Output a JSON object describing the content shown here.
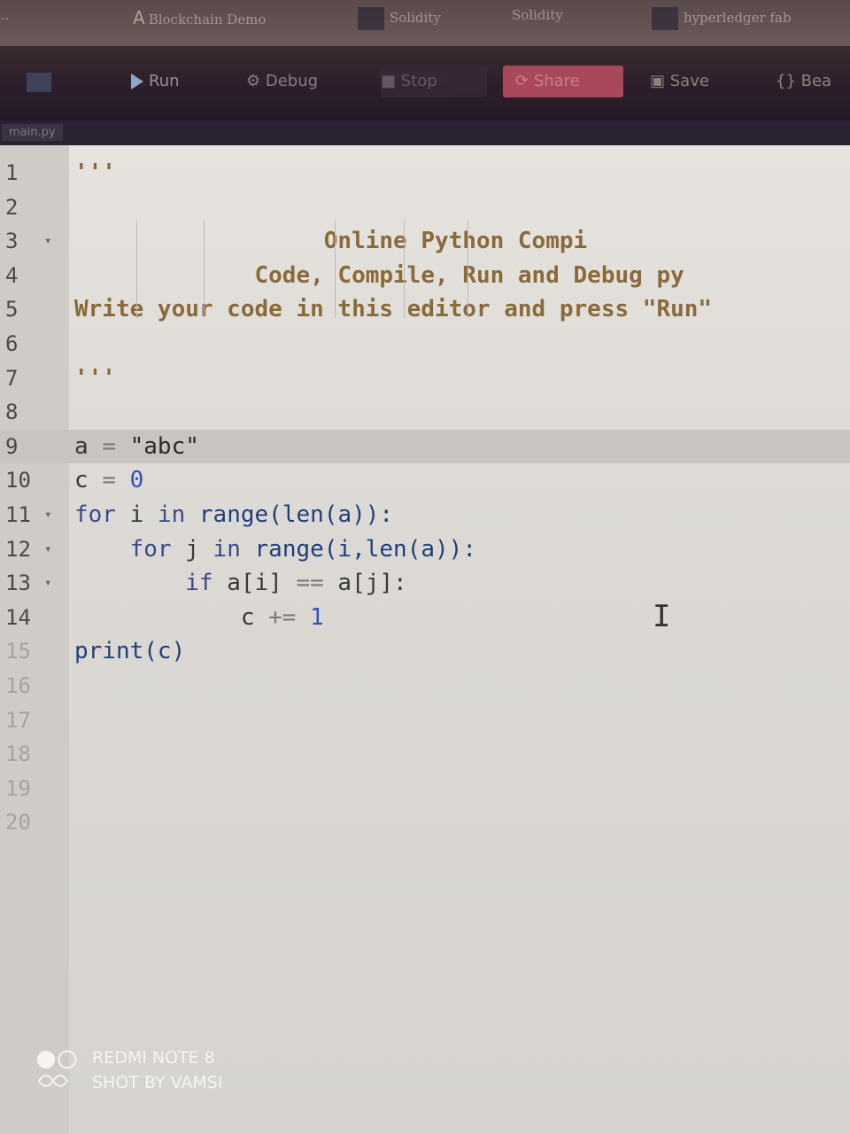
{
  "bookmarks": [
    {
      "label": "...",
      "icon": "bookmark-icon"
    },
    {
      "label": "Blockchain Demo",
      "icon": "letter-a-icon"
    },
    {
      "label": "Solidity",
      "icon": "bookmark-icon"
    },
    {
      "label": "Solidity",
      "icon": "none"
    },
    {
      "label": "hyperledger fab",
      "icon": "bookmark-icon"
    }
  ],
  "toolbar": {
    "run_label": "Run",
    "debug_label": "Debug",
    "stop_label": "Stop",
    "share_label": "Share",
    "save_label": "Save",
    "beautify_label": "{} Bea"
  },
  "file_tab": "main.py",
  "editor": {
    "lines": [
      {
        "n": "1",
        "segments": [
          {
            "t": "'''",
            "c": "cmt"
          }
        ]
      },
      {
        "n": "2",
        "segments": []
      },
      {
        "n": "3",
        "segments": [
          {
            "t": "                  Online Python Compi",
            "c": "cmt"
          }
        ]
      },
      {
        "n": "4",
        "segments": [
          {
            "t": "             Code, Compile, Run and Debug py",
            "c": "cmt"
          }
        ]
      },
      {
        "n": "5",
        "segments": [
          {
            "t": "Write your code in this editor and press \"Run\"",
            "c": "cmt"
          }
        ]
      },
      {
        "n": "6",
        "segments": []
      },
      {
        "n": "7",
        "segments": [
          {
            "t": "'''",
            "c": "cmt"
          }
        ]
      },
      {
        "n": "8",
        "segments": []
      },
      {
        "n": "9",
        "segments": [
          {
            "t": "a ",
            "c": "var"
          },
          {
            "t": "=",
            "c": "op"
          },
          {
            "t": " \"abc\"",
            "c": "str"
          }
        ]
      },
      {
        "n": "10",
        "segments": [
          {
            "t": "c ",
            "c": "var"
          },
          {
            "t": "=",
            "c": "op"
          },
          {
            "t": " 0",
            "c": "num"
          }
        ]
      },
      {
        "n": "11",
        "segments": [
          {
            "t": "for ",
            "c": "kw"
          },
          {
            "t": "i ",
            "c": "var"
          },
          {
            "t": "in ",
            "c": "kw"
          },
          {
            "t": "range(len(a)):",
            "c": "fn"
          }
        ]
      },
      {
        "n": "12",
        "segments": [
          {
            "t": "    for ",
            "c": "kw"
          },
          {
            "t": "j ",
            "c": "var"
          },
          {
            "t": "in ",
            "c": "kw"
          },
          {
            "t": "range(i,len(a)):",
            "c": "fn"
          }
        ]
      },
      {
        "n": "13",
        "segments": [
          {
            "t": "        if ",
            "c": "kw"
          },
          {
            "t": "a[i] ",
            "c": "var"
          },
          {
            "t": "==",
            "c": "op"
          },
          {
            "t": " a[j]:",
            "c": "var"
          }
        ]
      },
      {
        "n": "14",
        "segments": [
          {
            "t": "            c ",
            "c": "var"
          },
          {
            "t": "+=",
            "c": "op"
          },
          {
            "t": " 1",
            "c": "num"
          }
        ]
      },
      {
        "n": "15",
        "segments": [
          {
            "t": "print(c)",
            "c": "fn"
          }
        ]
      },
      {
        "n": "16",
        "segments": []
      },
      {
        "n": "17",
        "segments": []
      },
      {
        "n": "18",
        "segments": []
      },
      {
        "n": "19",
        "segments": []
      },
      {
        "n": "20",
        "segments": []
      }
    ],
    "fold_marker": "▾"
  },
  "watermark": {
    "line1": "REDMI NOTE 8",
    "line2": "SHOT BY VAMSI"
  }
}
